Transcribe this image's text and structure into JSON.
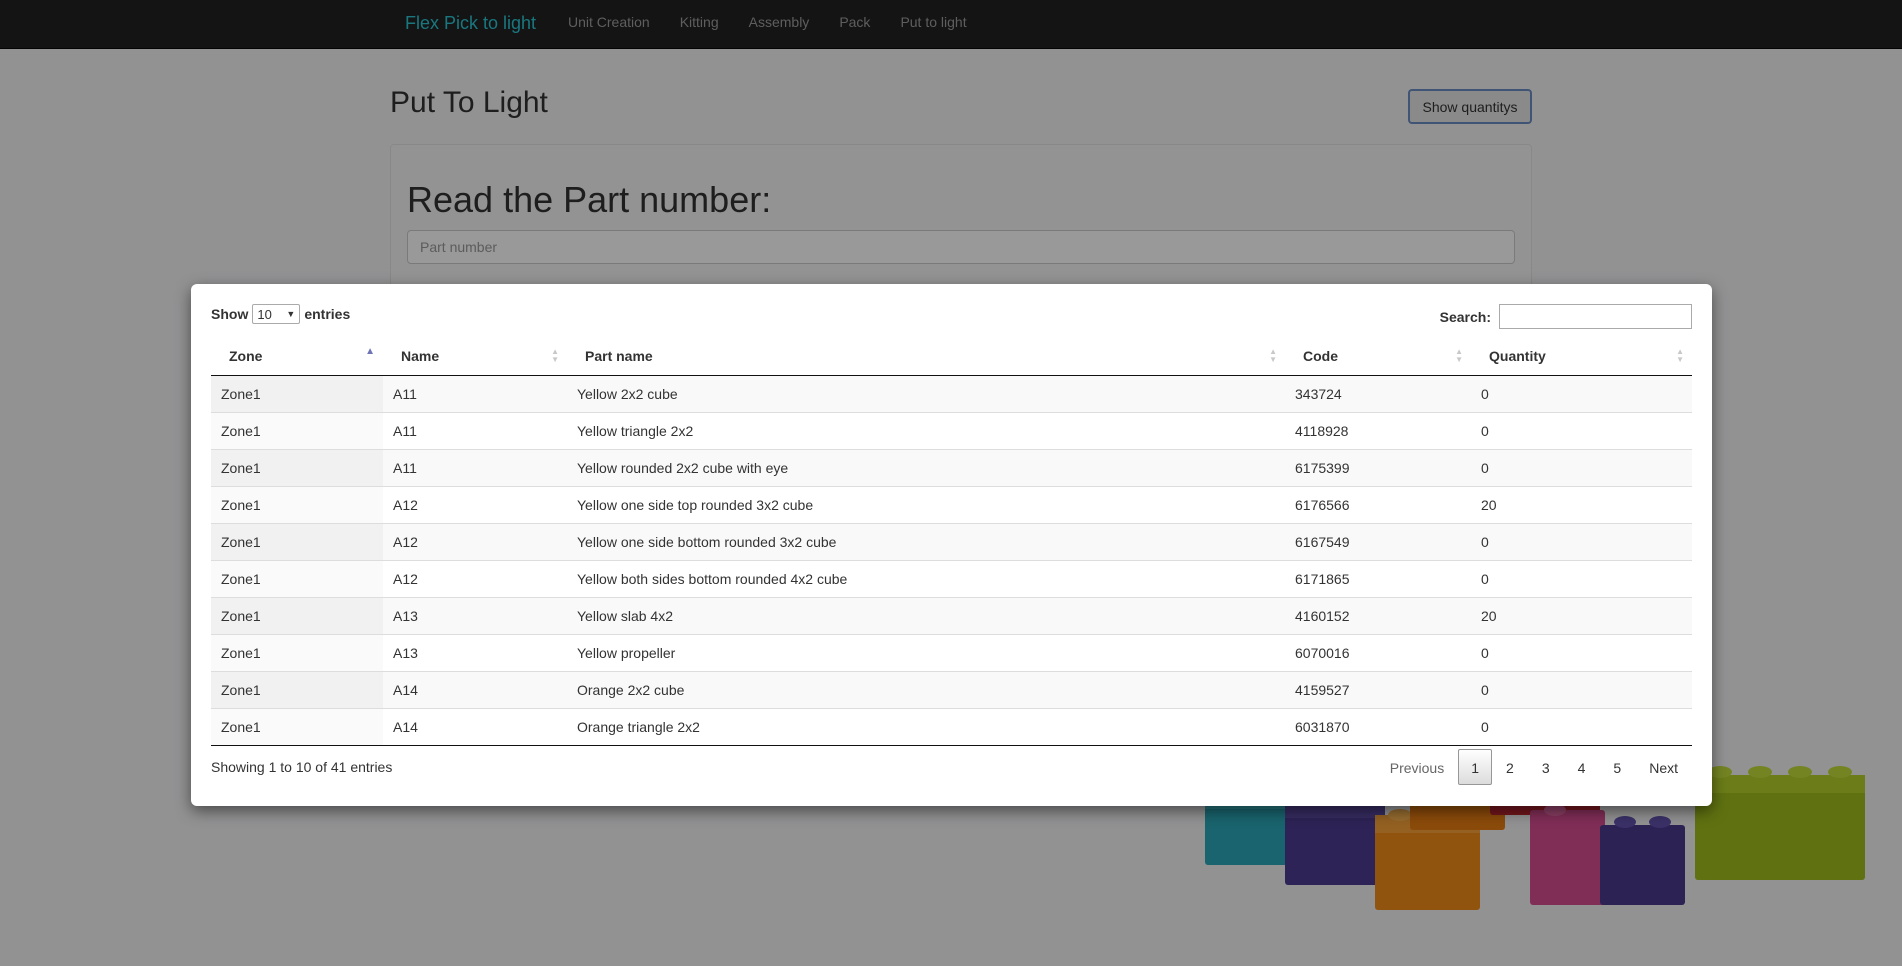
{
  "navbar": {
    "brand": "Flex Pick to light",
    "links": [
      "Unit Creation",
      "Kitting",
      "Assembly",
      "Pack",
      "Put to light"
    ]
  },
  "page": {
    "title": "Put To Light",
    "show_quantities_label": "Show quantitys",
    "well_heading": "Read the Part number:",
    "part_number_placeholder": "Part number"
  },
  "modal": {
    "length": {
      "show_label": "Show",
      "value": "10",
      "entries_label": "entries"
    },
    "search_label": "Search:",
    "search_value": "",
    "columns": [
      "Zone",
      "Name",
      "Part name",
      "Code",
      "Quantity"
    ],
    "rows": [
      [
        "Zone1",
        "A11",
        "Yellow 2x2 cube",
        "343724",
        "0"
      ],
      [
        "Zone1",
        "A11",
        "Yellow triangle 2x2",
        "4118928",
        "0"
      ],
      [
        "Zone1",
        "A11",
        "Yellow rounded 2x2 cube with eye",
        "6175399",
        "0"
      ],
      [
        "Zone1",
        "A12",
        "Yellow one side top rounded 3x2 cube",
        "6176566",
        "20"
      ],
      [
        "Zone1",
        "A12",
        "Yellow one side bottom rounded 3x2 cube",
        "6167549",
        "0"
      ],
      [
        "Zone1",
        "A12",
        "Yellow both sides bottom rounded 4x2 cube",
        "6171865",
        "0"
      ],
      [
        "Zone1",
        "A13",
        "Yellow slab 4x2",
        "4160152",
        "20"
      ],
      [
        "Zone1",
        "A13",
        "Yellow propeller",
        "6070016",
        "0"
      ],
      [
        "Zone1",
        "A14",
        "Orange 2x2 cube",
        "4159527",
        "0"
      ],
      [
        "Zone1",
        "A14",
        "Orange triangle 2x2",
        "6031870",
        "0"
      ]
    ],
    "info": "Showing 1 to 10 of 41 entries",
    "pagination": {
      "previous": "Previous",
      "pages": [
        "1",
        "2",
        "3",
        "4",
        "5"
      ],
      "current": "1",
      "next": "Next"
    }
  },
  "colors": {
    "navbar_bg": "#222222",
    "brand": "#2bc6d4",
    "sort_active": "#6f74b6"
  },
  "icons": {
    "sort_asc": "sort-asc-icon",
    "sort_both": "sort-both-icon",
    "select_caret": "caret-down-icon"
  }
}
